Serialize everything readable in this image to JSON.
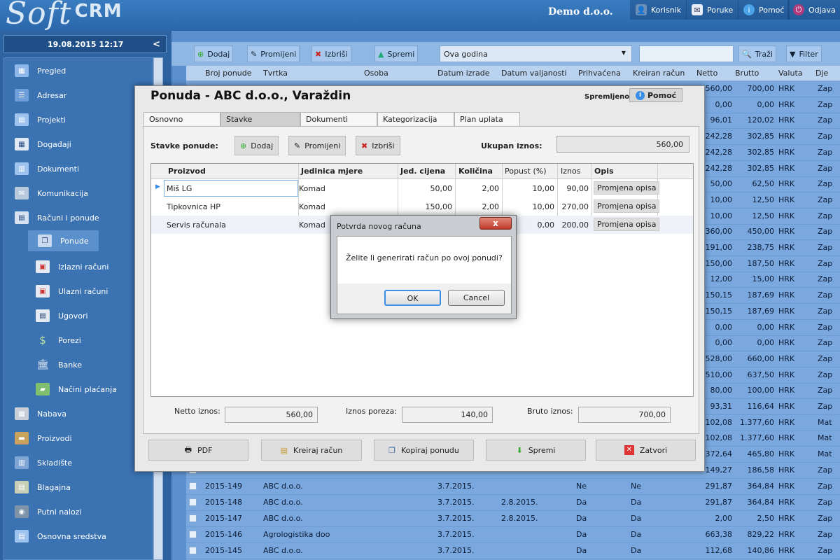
{
  "app": {
    "logo_script": "Soft",
    "logo_crm": "CRM",
    "company": "Demo d.o.o.",
    "nav": [
      {
        "label": "Korisnik"
      },
      {
        "label": "Poruke"
      },
      {
        "label": "Pomoć"
      },
      {
        "label": "Odjava"
      }
    ]
  },
  "sidebar": {
    "datetime": "19.08.2015 12:17",
    "collapse": "<",
    "items": [
      {
        "label": "Pregled"
      },
      {
        "label": "Adresar"
      },
      {
        "label": "Projekti"
      },
      {
        "label": "Događaji"
      },
      {
        "label": "Dokumenti"
      },
      {
        "label": "Komunikacija"
      },
      {
        "label": "Računi i ponude"
      },
      {
        "label": "Ponude"
      },
      {
        "label": "Izlazni računi"
      },
      {
        "label": "Ulazni računi"
      },
      {
        "label": "Ugovori"
      },
      {
        "label": "Porezi"
      },
      {
        "label": "Banke"
      },
      {
        "label": "Načini plaćanja"
      },
      {
        "label": "Nabava"
      },
      {
        "label": "Proizvodi"
      },
      {
        "label": "Skladište"
      },
      {
        "label": "Blagajna"
      },
      {
        "label": "Putni nalozi"
      },
      {
        "label": "Osnovna sredstva"
      }
    ]
  },
  "toolbar": {
    "add": "Dodaj",
    "edit": "Promijeni",
    "delete": "Izbriši",
    "save": "Spremi",
    "period": "Ova godina",
    "search": "Traži",
    "filter": "Filter"
  },
  "grid": {
    "headers": [
      "Broj ponude",
      "Tvrtka",
      "Osoba",
      "Datum izrade",
      "Datum valjanosti",
      "Prihvaćena",
      "Kreiran račun",
      "Netto",
      "Brutto",
      "Valuta",
      "Dje"
    ],
    "bg_rows": [
      {
        "netto": "560,00",
        "brutto": "700,00",
        "valuta": "HRK",
        "dje": "Zap"
      },
      {
        "netto": "0,00",
        "brutto": "0,00",
        "valuta": "HRK",
        "dje": "Zap"
      },
      {
        "netto": "96,01",
        "brutto": "120,02",
        "valuta": "HRK",
        "dje": "Zap"
      },
      {
        "netto": "242,28",
        "brutto": "302,85",
        "valuta": "HRK",
        "dje": "Zap"
      },
      {
        "netto": "242,28",
        "brutto": "302,85",
        "valuta": "HRK",
        "dje": "Zap"
      },
      {
        "netto": "242,28",
        "brutto": "302,85",
        "valuta": "HRK",
        "dje": "Zap"
      },
      {
        "netto": "50,00",
        "brutto": "62,50",
        "valuta": "HRK",
        "dje": "Zap"
      },
      {
        "netto": "10,00",
        "brutto": "12,50",
        "valuta": "HRK",
        "dje": "Zap"
      },
      {
        "netto": "10,00",
        "brutto": "12,50",
        "valuta": "HRK",
        "dje": "Zap"
      },
      {
        "netto": "360,00",
        "brutto": "450,00",
        "valuta": "HRK",
        "dje": "Zap"
      },
      {
        "netto": "191,00",
        "brutto": "238,75",
        "valuta": "HRK",
        "dje": "Zap"
      },
      {
        "netto": "150,00",
        "brutto": "187,50",
        "valuta": "HRK",
        "dje": "Zap"
      },
      {
        "netto": "12,00",
        "brutto": "15,00",
        "valuta": "HRK",
        "dje": "Zap"
      },
      {
        "netto": "150,15",
        "brutto": "187,69",
        "valuta": "HRK",
        "dje": "Zap"
      },
      {
        "netto": "150,15",
        "brutto": "187,69",
        "valuta": "HRK",
        "dje": "Zap"
      },
      {
        "netto": "0,00",
        "brutto": "0,00",
        "valuta": "HRK",
        "dje": "Zap"
      },
      {
        "netto": "0,00",
        "brutto": "0,00",
        "valuta": "HRK",
        "dje": "Zap"
      },
      {
        "netto": "528,00",
        "brutto": "660,00",
        "valuta": "HRK",
        "dje": "Zap"
      },
      {
        "netto": "510,00",
        "brutto": "637,50",
        "valuta": "HRK",
        "dje": "Zap"
      },
      {
        "netto": "80,00",
        "brutto": "100,00",
        "valuta": "HRK",
        "dje": "Zap"
      },
      {
        "netto": "93,31",
        "brutto": "116,64",
        "valuta": "HRK",
        "dje": "Zap"
      },
      {
        "netto": "102,08",
        "brutto": "1.377,60",
        "valuta": "HRK",
        "dje": "Mat"
      },
      {
        "netto": "102,08",
        "brutto": "1.377,60",
        "valuta": "HRK",
        "dje": "Mat"
      },
      {
        "netto": "372,64",
        "brutto": "465,80",
        "valuta": "HRK",
        "dje": "Mat"
      },
      {
        "netto": "149,27",
        "brutto": "186,58",
        "valuta": "HRK",
        "dje": "Zap"
      }
    ],
    "rows": [
      {
        "broj": "2015-149",
        "tvrtka": "ABC d.o.o.",
        "datum": "3.7.2015.",
        "valjanost": "",
        "prihvacena": "Ne",
        "kreiran": "Ne",
        "netto": "291,87",
        "brutto": "364,84",
        "valuta": "HRK",
        "dje": "Zap"
      },
      {
        "broj": "2015-148",
        "tvrtka": "ABC d.o.o.",
        "datum": "3.7.2015.",
        "valjanost": "2.8.2015.",
        "prihvacena": "Da",
        "kreiran": "Da",
        "netto": "291,87",
        "brutto": "364,84",
        "valuta": "HRK",
        "dje": "Zap"
      },
      {
        "broj": "2015-147",
        "tvrtka": "ABC d.o.o.",
        "datum": "3.7.2015.",
        "valjanost": "2.8.2015.",
        "prihvacena": "Da",
        "kreiran": "Da",
        "netto": "2,00",
        "brutto": "2,50",
        "valuta": "HRK",
        "dje": "Zap"
      },
      {
        "broj": "2015-146",
        "tvrtka": "Agrologistika doo",
        "datum": "3.7.2015.",
        "valjanost": "",
        "prihvacena": "Da",
        "kreiran": "Da",
        "netto": "663,38",
        "brutto": "829,22",
        "valuta": "HRK",
        "dje": "Zap"
      },
      {
        "broj": "2015-145",
        "tvrtka": "ABC d.o.o.",
        "datum": "3.7.2015.",
        "valjanost": "",
        "prihvacena": "Da",
        "kreiran": "Da",
        "netto": "112,68",
        "brutto": "140,86",
        "valuta": "HRK",
        "dje": "Zap"
      }
    ]
  },
  "dialog": {
    "title": "Ponuda - ABC d.o.o., Varaždin",
    "saved": "Spremljeno",
    "help": "Pomoć",
    "tabs": [
      "Osnovno",
      "Stavke",
      "Dokumenti",
      "Kategorizacija",
      "Plan uplata"
    ],
    "items_label": "Stavke ponude:",
    "add": "Dodaj",
    "edit": "Promijeni",
    "delete": "Izbriši",
    "total_label": "Ukupan iznos:",
    "total": "560,00",
    "columns": [
      "Proizvod",
      "Jedinica mjere",
      "Jed. cijena",
      "Količina",
      "Popust (%)",
      "Iznos",
      "Opis"
    ],
    "items": [
      {
        "proizvod": "Miš LG",
        "jedinica": "Komad",
        "cijena": "50,00",
        "kolicina": "2,00",
        "popust": "10,00",
        "iznos": "90,00",
        "opis": "Promjena opisa"
      },
      {
        "proizvod": "Tipkovnica HP",
        "jedinica": "Komad",
        "cijena": "150,00",
        "kolicina": "2,00",
        "popust": "10,00",
        "iznos": "270,00",
        "opis": "Promjena opisa"
      },
      {
        "proizvod": "Servis računala",
        "jedinica": "Komad",
        "cijena": "",
        "kolicina": "",
        "popust": "0,00",
        "iznos": "200,00",
        "opis": "Promjena opisa"
      }
    ],
    "netto_label": "Netto iznos:",
    "netto": "560,00",
    "porez_label": "Iznos poreza:",
    "porez": "140,00",
    "bruto_label": "Bruto iznos:",
    "bruto": "700,00",
    "buttons": {
      "pdf": "PDF",
      "invoice": "Kreiraj račun",
      "copy": "Kopiraj ponudu",
      "save": "Spremi",
      "close": "Zatvori"
    }
  },
  "confirm": {
    "title": "Potvrda novog računa",
    "close": "x",
    "message": "Želite li generirati račun po ovoj ponudi?",
    "ok": "OK",
    "cancel": "Cancel"
  }
}
